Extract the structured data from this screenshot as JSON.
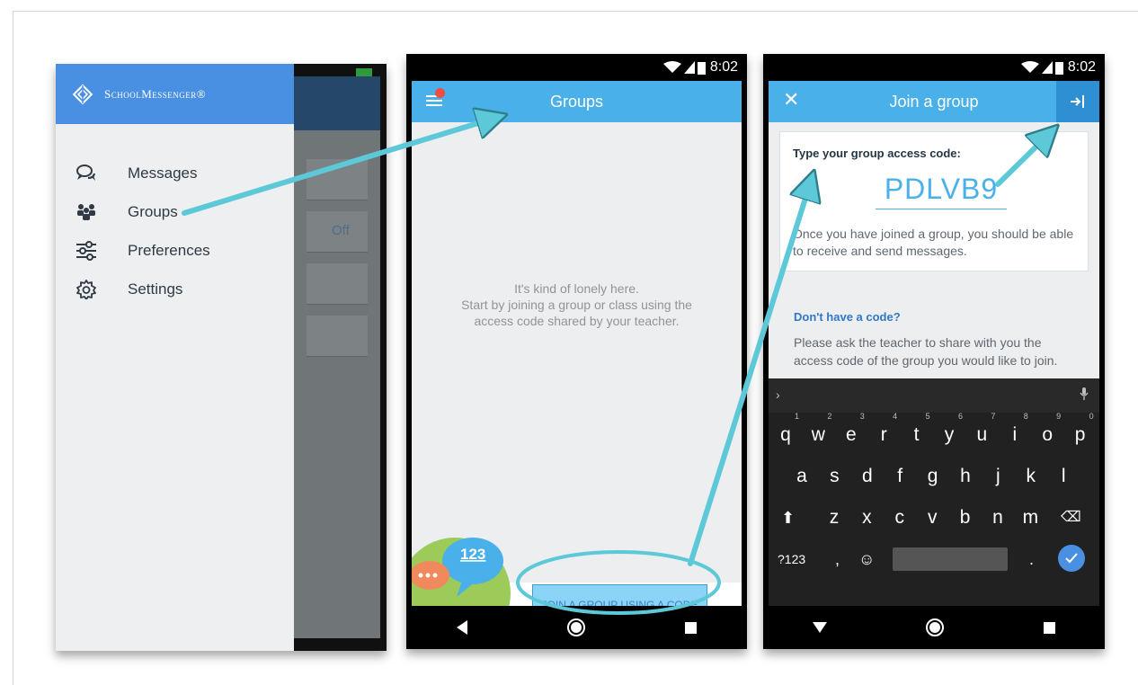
{
  "colors": {
    "accent": "#4ab0ea",
    "drawer_header": "#4a90e2",
    "arrow": "#5cc8d8",
    "badge": "#f04c3f"
  },
  "drawer": {
    "brand": "SchoolMessenger®",
    "logo_icon": "schoolmessenger-logo-icon",
    "menu": [
      {
        "label": "Messages",
        "icon": "chat-bubbles-icon"
      },
      {
        "label": "Groups",
        "icon": "people-icon"
      },
      {
        "label": "Preferences",
        "icon": "sliders-icon"
      },
      {
        "label": "Settings",
        "icon": "gear-icon"
      }
    ],
    "background_value": "Off"
  },
  "groups_screen": {
    "status_time": "8:02",
    "title": "Groups",
    "empty_line1": "It's kind of lonely here.",
    "empty_line2": "Start by joining a group or class using the",
    "empty_line3": "access code shared by your teacher.",
    "illustration_number": "123",
    "join_button": "JOIN A GROUP USING A CODE"
  },
  "join_screen": {
    "status_time": "8:02",
    "close": "✕",
    "title": "Join a group",
    "code_label": "Type your group access code:",
    "code_value": "PDLVB9",
    "help_text": "Once you have joined a group, you should be able to receive and send messages.",
    "no_code_title": "Don't have a code?",
    "no_code_text": "Please ask the teacher to share with you the access code of the group you would like to join."
  },
  "keyboard": {
    "row1": [
      {
        "key": "q",
        "hint": "1"
      },
      {
        "key": "w",
        "hint": "2"
      },
      {
        "key": "e",
        "hint": "3"
      },
      {
        "key": "r",
        "hint": "4"
      },
      {
        "key": "t",
        "hint": "5"
      },
      {
        "key": "y",
        "hint": "6"
      },
      {
        "key": "u",
        "hint": "7"
      },
      {
        "key": "i",
        "hint": "8"
      },
      {
        "key": "o",
        "hint": "9"
      },
      {
        "key": "p",
        "hint": "0"
      }
    ],
    "row2": [
      "a",
      "s",
      "d",
      "f",
      "g",
      "h",
      "j",
      "k",
      "l"
    ],
    "row3": [
      "z",
      "x",
      "c",
      "v",
      "b",
      "n",
      "m"
    ],
    "symbols_key": "?123",
    "comma_key": ",",
    "period_key": "."
  }
}
